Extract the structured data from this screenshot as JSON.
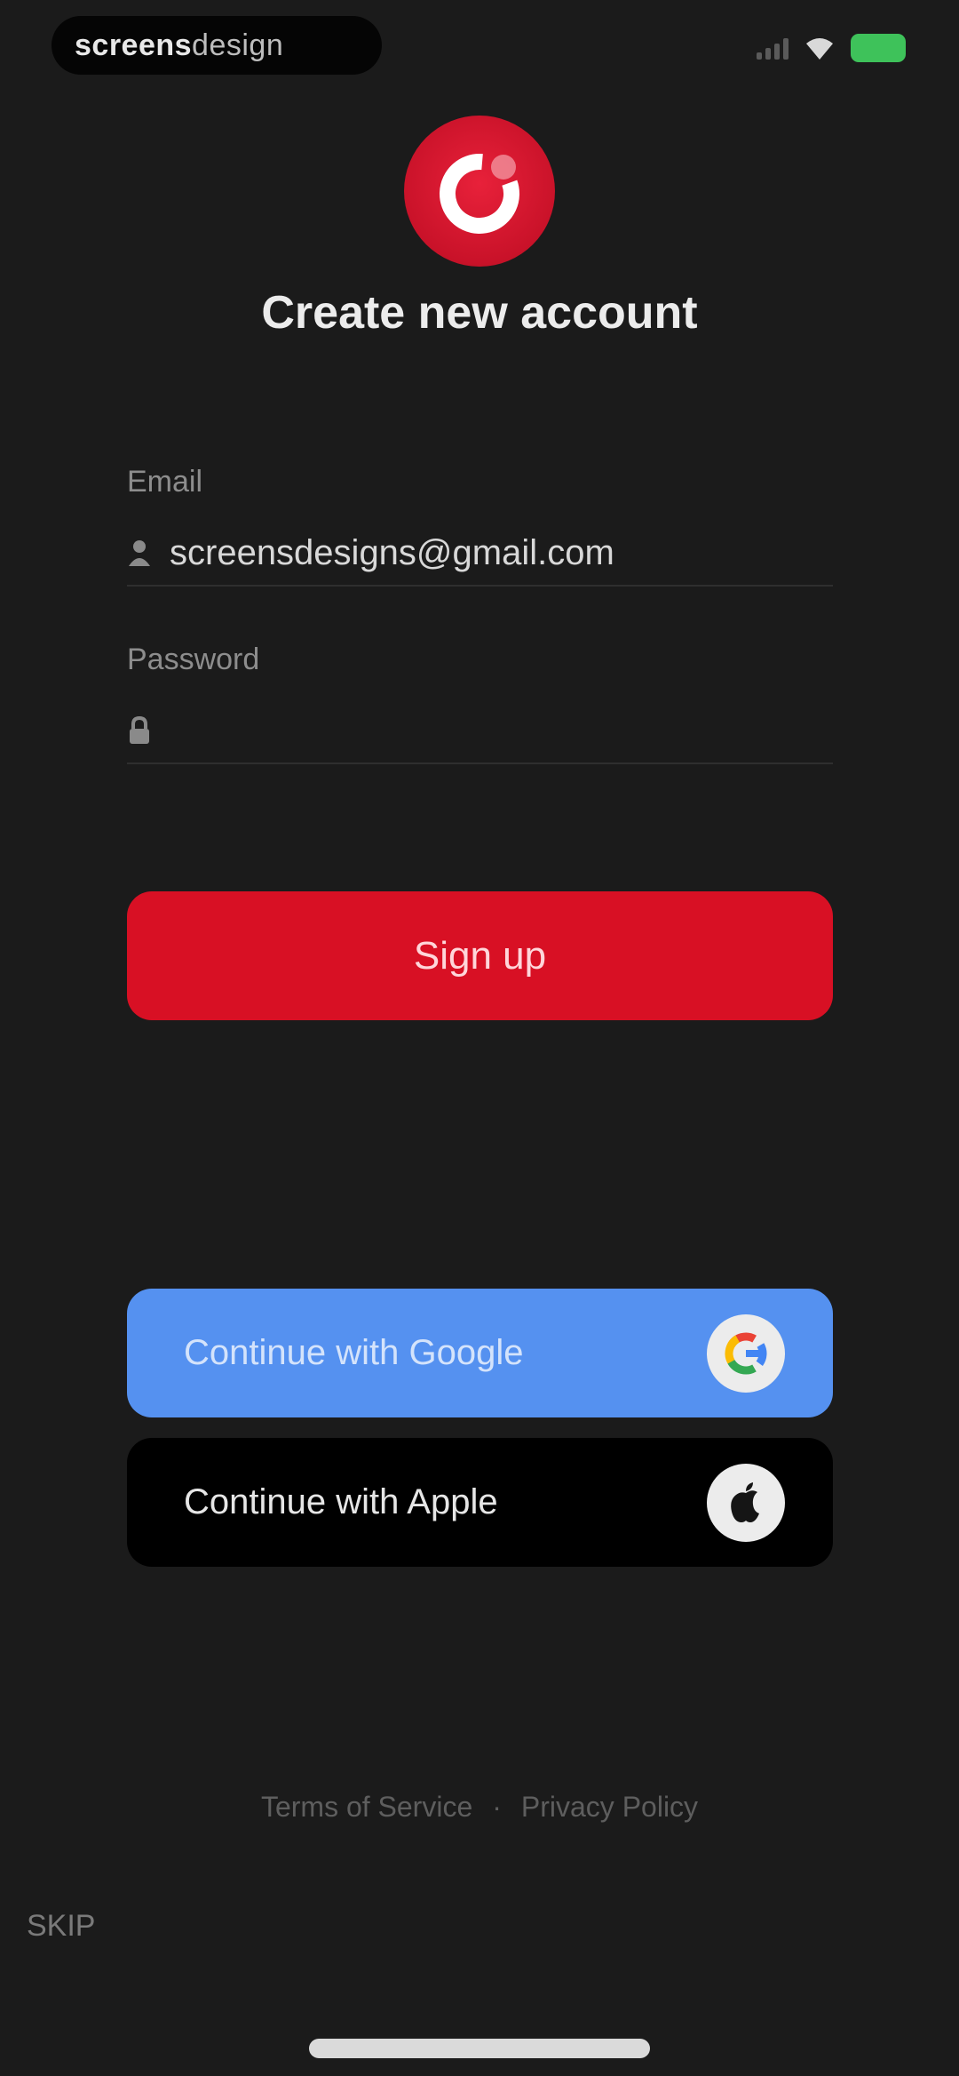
{
  "status_bar": {
    "brand_bold": "screens",
    "brand_light": "design",
    "battery_color": "#3ec25a"
  },
  "logo": {
    "icon": "brand-ring-logo",
    "color": "#d81024"
  },
  "title": "Create new account",
  "form": {
    "email": {
      "label": "Email",
      "value": "screensdesigns@gmail.com",
      "icon": "user-icon"
    },
    "password": {
      "label": "Password",
      "value": "",
      "icon": "lock-icon"
    },
    "signup_label": "Sign up",
    "signup_color": "#d81024"
  },
  "social": {
    "google_label": "Continue with Google",
    "google_color": "#5591f0",
    "apple_label": "Continue with Apple",
    "apple_color": "#000000"
  },
  "footer": {
    "terms": "Terms of Service",
    "separator": "·",
    "privacy": "Privacy Policy",
    "skip": "SKIP"
  }
}
